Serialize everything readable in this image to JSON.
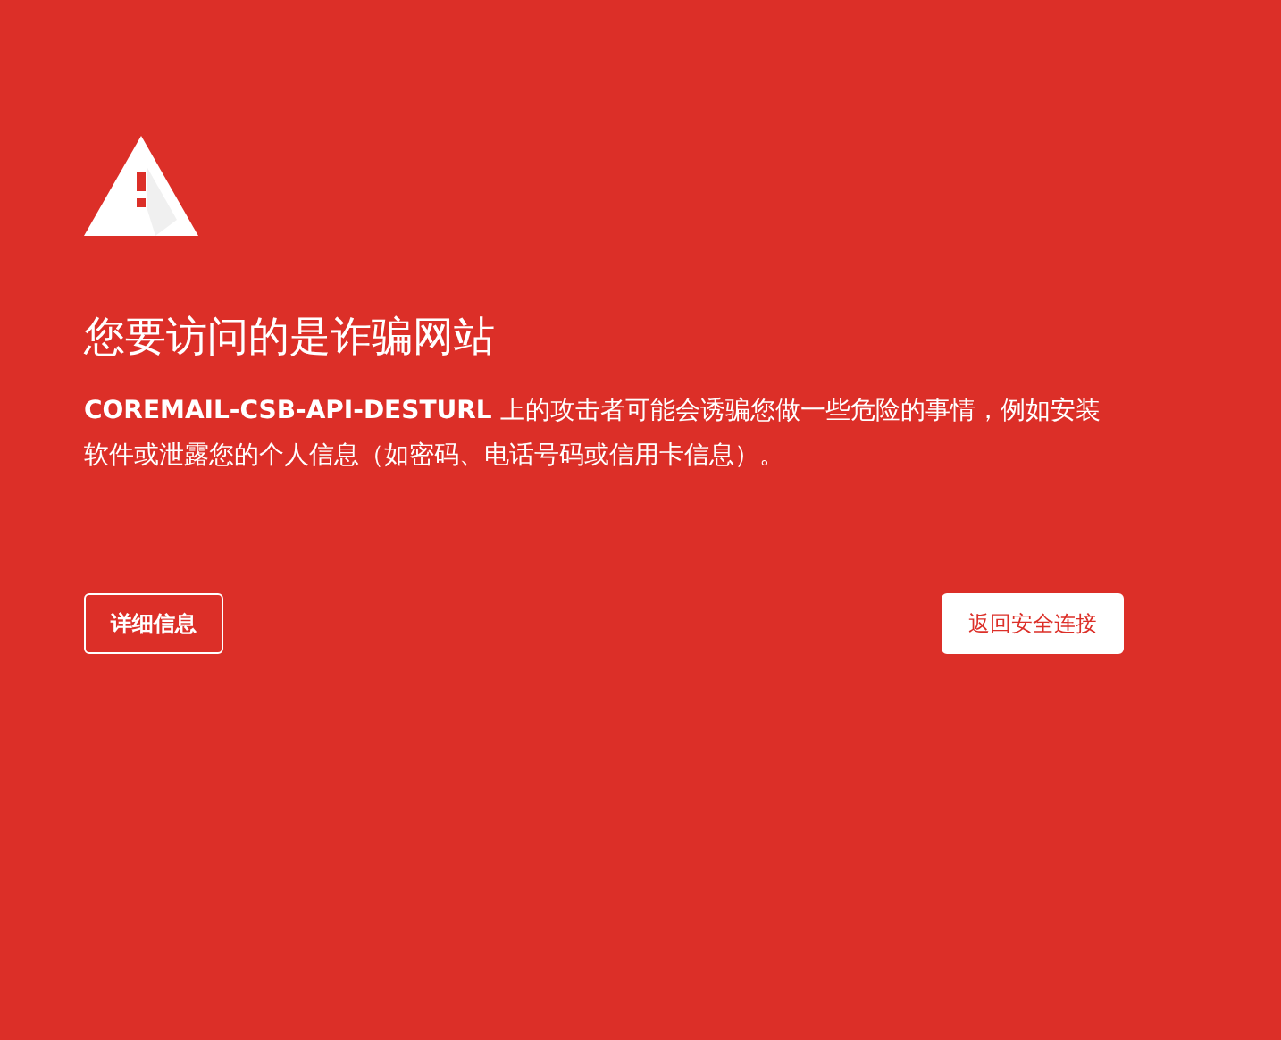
{
  "heading": "您要访问的是诈骗网站",
  "message": "**COREMAIL-CSB-API-DESTURL** 上的攻击者可能会诱骗您做一些危险的事情，例如安装软件或泄露您的个人信息（如密码、电话号码或信用卡信息）。",
  "buttons": [
    {
      "label": "详细信息",
      "kind": "outline"
    },
    {
      "label": "返回安全连接",
      "kind": "primary"
    }
  ]
}
